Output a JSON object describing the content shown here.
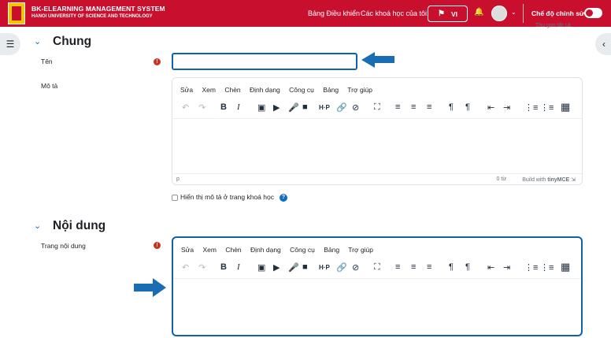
{
  "header": {
    "brand_title": "BK-ELEARNING MANAGEMENT SYSTEM",
    "brand_subtitle": "HANOI UNIVERSITY OF SCIENCE AND TECHNOLOGY",
    "nav_dashboard": "Bảng Điều khiển",
    "nav_my_courses": "Các khoá học của tôi",
    "language": "VI",
    "edit_mode_label": "Chế độ chỉnh sửa",
    "edit_mode_on": true,
    "accent_color": "#c8102e"
  },
  "collapse_all_link": "Thu gọn tất cả",
  "sections": {
    "general": {
      "title": "Chung"
    },
    "content": {
      "title": "Nội dung"
    }
  },
  "fields": {
    "name_label": "Tên",
    "description_label": "Mô tả",
    "page_content_label": "Trang nội dung",
    "show_description_label": "Hiển thị mô tả ở trang khoá học"
  },
  "editor": {
    "menu": [
      "Sửa",
      "Xem",
      "Chèn",
      "Định dạng",
      "Công cụ",
      "Bảng",
      "Trợ giúp"
    ],
    "toolbar_icons": [
      "undo-icon",
      "redo-icon",
      "bold-icon",
      "italic-icon",
      "image-icon",
      "media-icon",
      "record-audio-icon",
      "record-video-icon",
      "h5p-icon",
      "link-icon",
      "unlink-icon",
      "fullscreen-icon",
      "align-left-icon",
      "align-center-icon",
      "align-right-icon",
      "ltr-icon",
      "rtl-icon",
      "outdent-icon",
      "indent-icon",
      "bullet-list-icon",
      "numbered-list-icon",
      "calculator-icon"
    ],
    "status_path": "p",
    "word_count": "0 từ",
    "built_with": "Build with",
    "tinymce": "tinyMCE"
  },
  "highlight_color": "#0f62a8",
  "arrow_color": "#1b6db3"
}
